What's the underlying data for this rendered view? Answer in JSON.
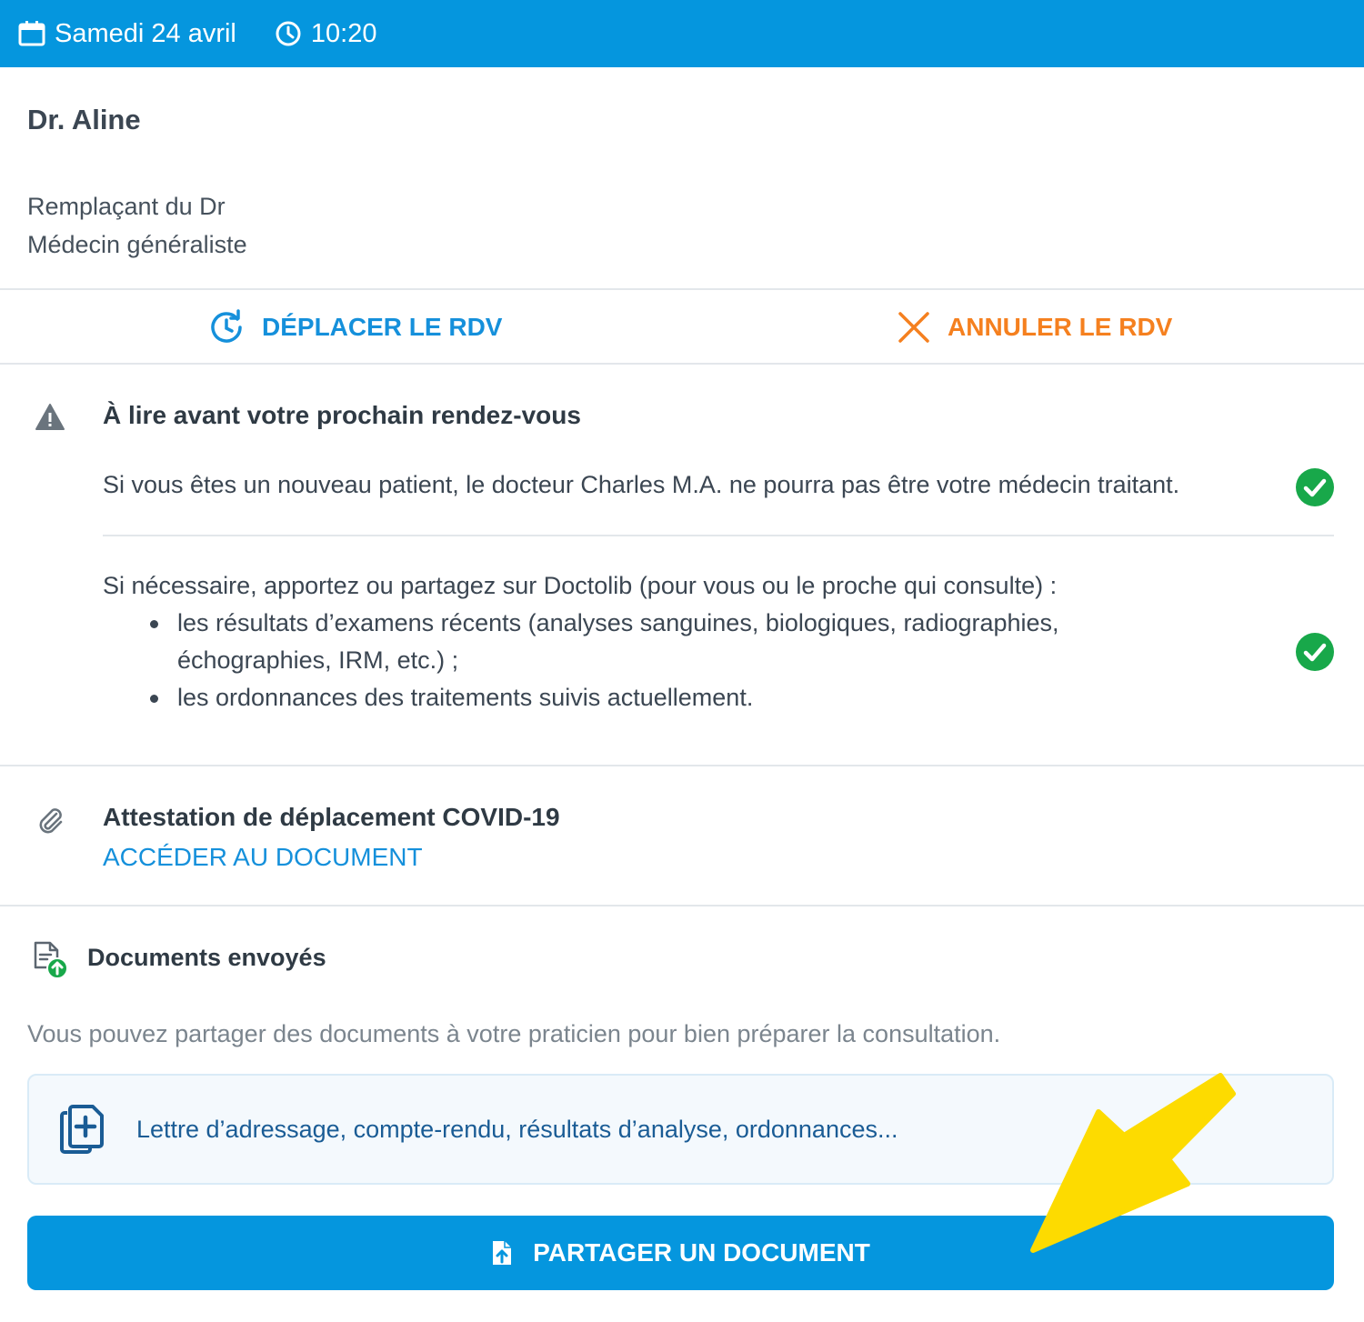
{
  "appointment": {
    "date": "Samedi 24 avril",
    "time": "10:20"
  },
  "doctor": {
    "name": "Dr. Aline",
    "replacement": "Remplaçant du Dr",
    "specialty": "Médecin généraliste"
  },
  "actions": {
    "move_label": "DÉPLACER LE RDV",
    "cancel_label": "ANNULER LE RDV"
  },
  "notice": {
    "title": "À lire avant votre prochain rendez-vous",
    "item1": "Si vous êtes un nouveau patient, le docteur Charles M.A. ne pourra pas être votre médecin traitant.",
    "item2_intro": "Si nécessaire, apportez ou partagez sur Doctolib (pour vous ou le proche qui consulte) :",
    "item2_bullets": [
      "les résultats d’examens récents (analyses sanguines, biologiques, radiographies, échographies, IRM, etc.) ;",
      "les ordonnances des traitements suivis actuellement."
    ]
  },
  "attestation": {
    "title": "Attestation de déplacement COVID-19",
    "link_label": "ACCÉDER AU DOCUMENT"
  },
  "documents": {
    "title": "Documents envoyés",
    "description": "Vous pouvez partager des documents à votre praticien pour bien préparer la consultation.",
    "box_text": "Lettre d’adressage, compte-rendu, résultats d’analyse, ordonnances...",
    "share_label": "PARTAGER UN DOCUMENT"
  },
  "colors": {
    "primary": "#0596de",
    "cancel": "#f5801f",
    "success": "#18a84a",
    "annotation_arrow": "#fddb00"
  },
  "icons": [
    "calendar-icon",
    "clock-icon",
    "reschedule-icon",
    "close-icon",
    "warning-icon",
    "check-circle-icon",
    "paperclip-icon",
    "document-upload-icon",
    "add-document-icon",
    "file-upload-icon"
  ]
}
